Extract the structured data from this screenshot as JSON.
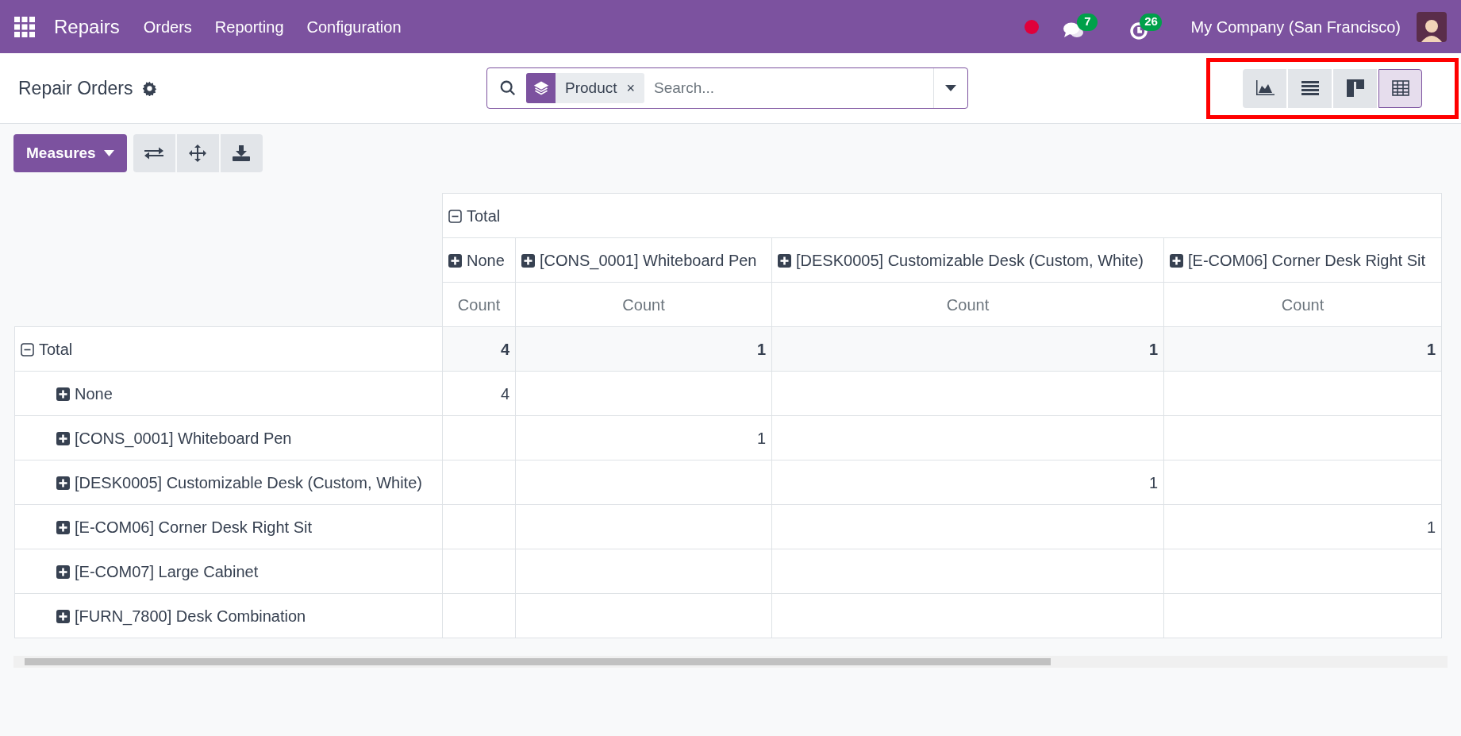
{
  "navbar": {
    "app_name": "Repairs",
    "menu": [
      "Orders",
      "Reporting",
      "Configuration"
    ],
    "messages_count": "7",
    "activities_count": "26",
    "company": "My Company (San Francisco)"
  },
  "control_panel": {
    "title": "Repair Orders",
    "search": {
      "facets": [
        {
          "label": "Product",
          "remove_symbol": "×"
        }
      ],
      "placeholder": "Search..."
    },
    "views": [
      {
        "kind": "graph",
        "selected": false
      },
      {
        "kind": "list",
        "selected": false
      },
      {
        "kind": "kanban",
        "selected": false
      },
      {
        "kind": "pivot",
        "selected": true
      }
    ]
  },
  "toolbar": {
    "measures_label": "Measures"
  },
  "pivot": {
    "column_group": {
      "label": "Total",
      "expanded": true
    },
    "columns": [
      {
        "label": "None",
        "expanded": false,
        "measure": "Count"
      },
      {
        "label": "[CONS_0001] Whiteboard Pen",
        "expanded": false,
        "measure": "Count"
      },
      {
        "label": "[DESK0005] Customizable Desk (Custom, White)",
        "expanded": false,
        "measure": "Count"
      },
      {
        "label": "[E-COM06] Corner Desk Right Sit",
        "expanded": false,
        "measure": "Count"
      }
    ],
    "total_row": {
      "label": "Total",
      "expanded": true,
      "cells": [
        {
          "value": "4"
        },
        {
          "value": "1"
        },
        {
          "value": "1"
        },
        {
          "value": "1"
        }
      ]
    },
    "rows": [
      {
        "label": "None",
        "expanded": false,
        "cells": [
          {
            "value": "4"
          },
          {},
          {},
          {}
        ]
      },
      {
        "label": "[CONS_0001] Whiteboard Pen",
        "expanded": false,
        "cells": [
          {},
          {
            "value": "1"
          },
          {},
          {}
        ]
      },
      {
        "label": "[DESK0005] Customizable Desk (Custom, White)",
        "expanded": false,
        "cells": [
          {},
          {},
          {
            "value": "1"
          },
          {}
        ]
      },
      {
        "label": "[E-COM06] Corner Desk Right Sit",
        "expanded": false,
        "cells": [
          {},
          {},
          {},
          {
            "value": "1"
          }
        ]
      },
      {
        "label": "[E-COM07] Large Cabinet",
        "expanded": false,
        "cells": [
          {},
          {},
          {},
          {}
        ]
      },
      {
        "label": "[FURN_7800] Desk Combination",
        "expanded": false,
        "cells": [
          {},
          {},
          {},
          {}
        ]
      }
    ]
  }
}
